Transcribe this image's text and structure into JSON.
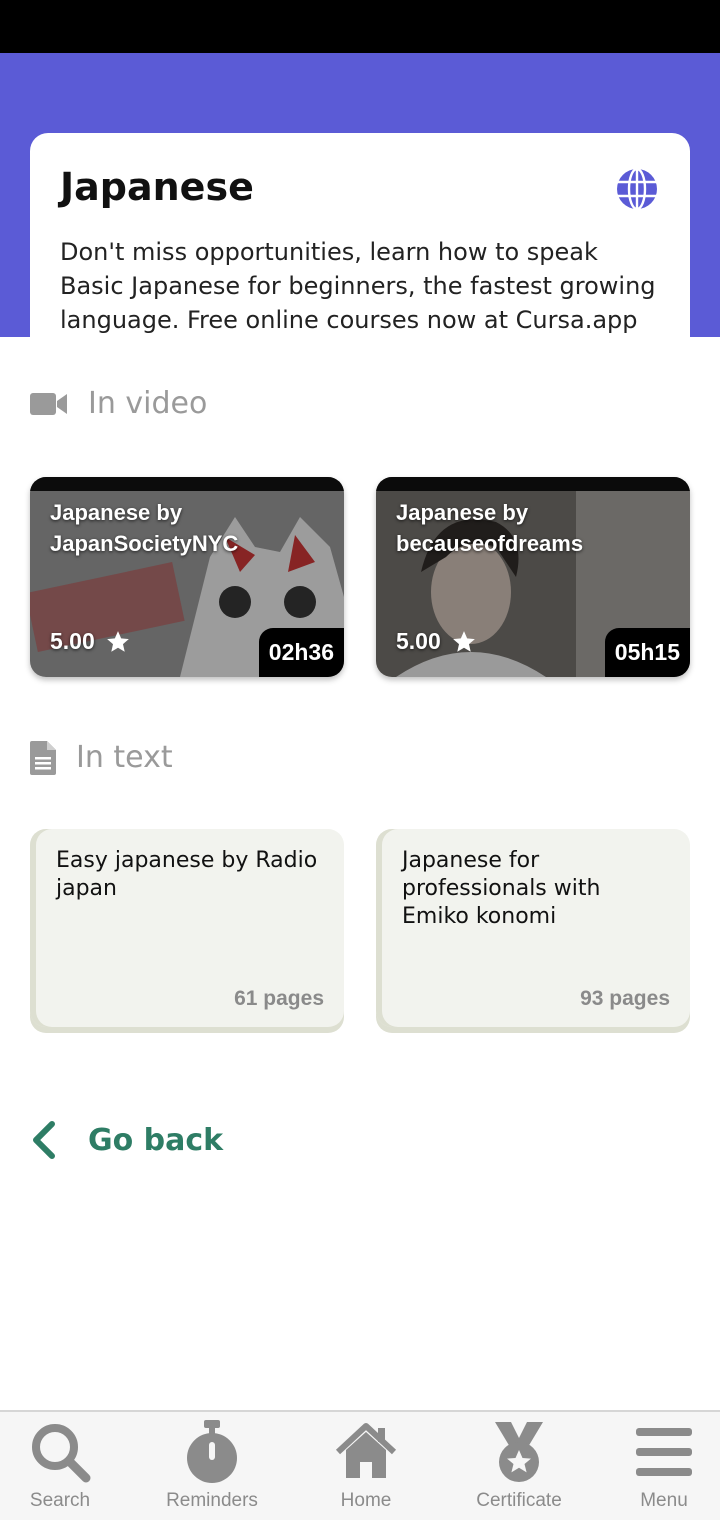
{
  "header": {
    "title": "Japanese",
    "description": "Don't miss opportunities, learn how to speak Basic Japanese for beginners, the fastest growing language. Free online courses now at Cursa.app",
    "icon": "globe-icon",
    "accent": "#5b5bd6"
  },
  "video_section": {
    "title": "In video",
    "icon": "video-camera-icon",
    "cards": [
      {
        "title": "Japanese by JapanSocietyNYC",
        "rating": "5.00",
        "duration": "02h36"
      },
      {
        "title": "Japanese by becauseofdreams",
        "rating": "5.00",
        "duration": "05h15"
      }
    ]
  },
  "text_section": {
    "title": "In text",
    "icon": "document-icon",
    "cards": [
      {
        "title": "Easy japanese by Radio japan",
        "pages": "61 pages"
      },
      {
        "title": "Japanese for professionals with Emiko konomi",
        "pages": "93 pages"
      }
    ]
  },
  "go_back": {
    "label": "Go back",
    "color": "#2e7d65"
  },
  "bottom_nav": {
    "items": [
      {
        "label": "Search",
        "icon": "search-icon"
      },
      {
        "label": "Reminders",
        "icon": "stopwatch-icon"
      },
      {
        "label": "Home",
        "icon": "home-icon"
      },
      {
        "label": "Certificate",
        "icon": "medal-icon"
      },
      {
        "label": "Menu",
        "icon": "menu-icon"
      }
    ]
  }
}
